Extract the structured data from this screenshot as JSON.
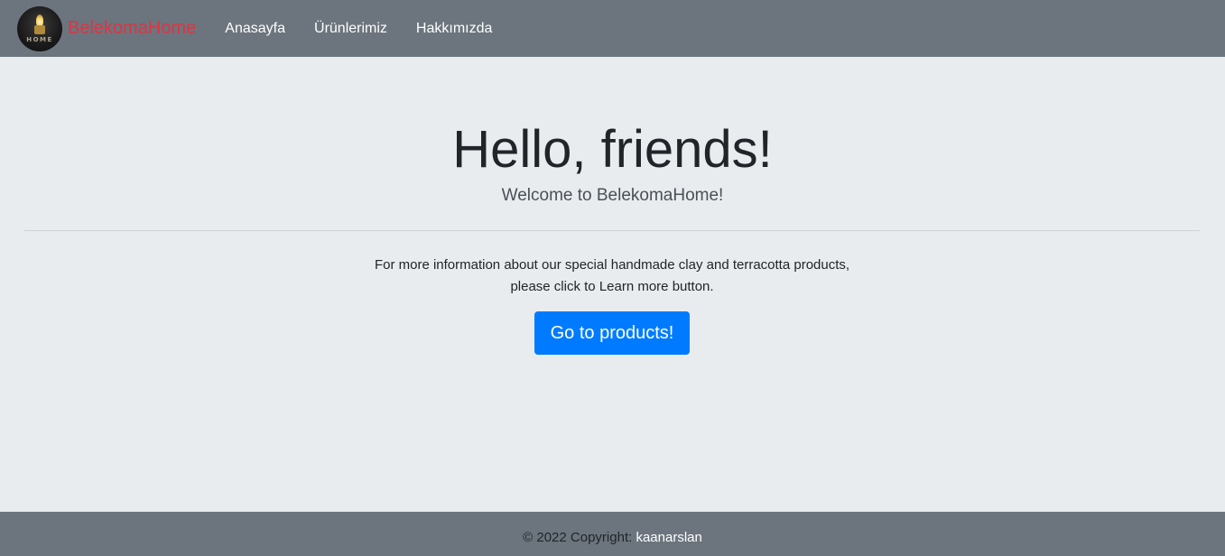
{
  "navbar": {
    "brand_name": "BelekomaHome",
    "logo_text": "HOME",
    "links": [
      {
        "label": "Anasayfa"
      },
      {
        "label": "Ürünlerimiz"
      },
      {
        "label": "Hakkımızda"
      }
    ]
  },
  "hero": {
    "title": "Hello, friends!",
    "subtitle": "Welcome to BelekomaHome!",
    "info_line1": "For more information about our special handmade clay and terracotta products,",
    "info_line2": "please click to Learn more button.",
    "button_label": "Go to products!"
  },
  "footer": {
    "copyright": "© 2022 Copyright:",
    "author_link": "kaanarslan"
  },
  "colors": {
    "navbar_bg": "#6c757d",
    "brand": "#dc3545",
    "page_bg": "#e9ecef",
    "primary_button": "#007bff"
  }
}
